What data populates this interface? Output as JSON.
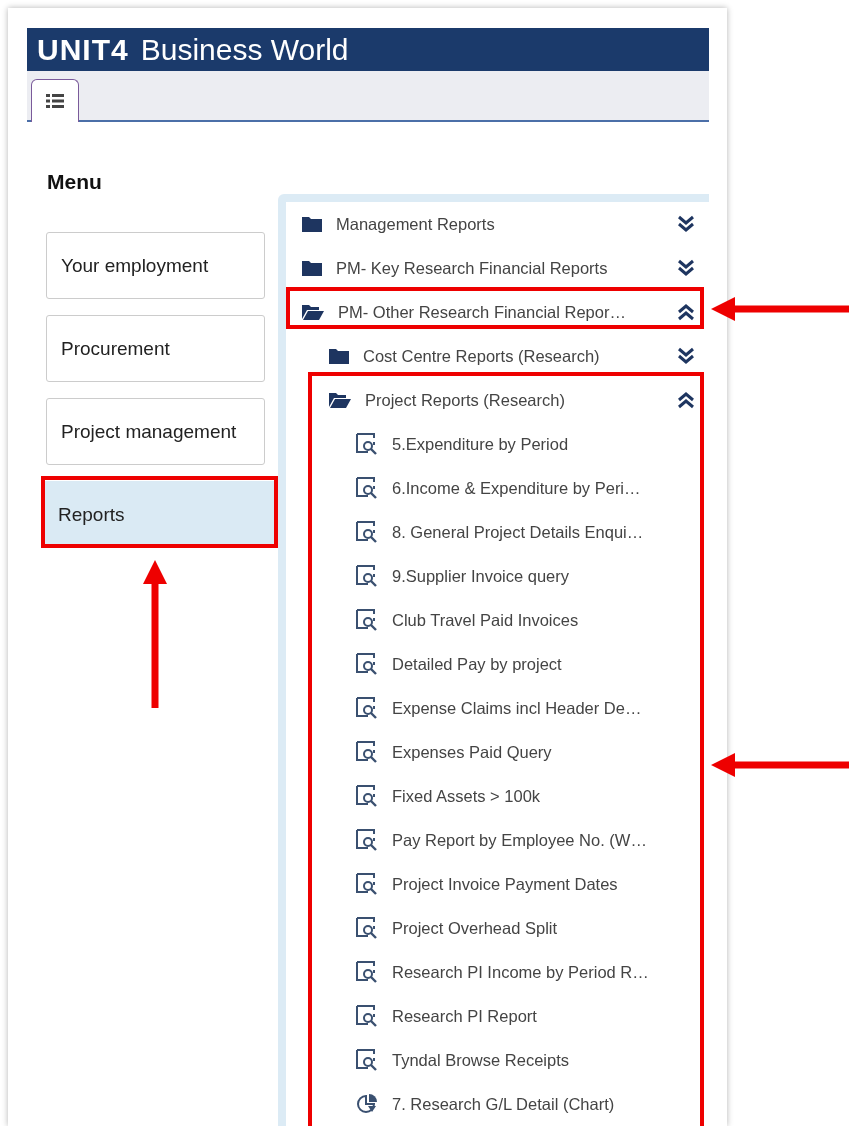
{
  "header": {
    "logo": "UNIT4",
    "title": "Business World"
  },
  "tabs": [
    {
      "selected": true
    }
  ],
  "menu": {
    "title": "Menu",
    "items": [
      {
        "label": "Your employment",
        "selected": false
      },
      {
        "label": "Procurement",
        "selected": false
      },
      {
        "label": "Project management",
        "selected": false
      },
      {
        "label": "Reports",
        "selected": true
      }
    ]
  },
  "tree": [
    {
      "kind": "folder",
      "label": "Management Reports",
      "expanded": false
    },
    {
      "kind": "folder",
      "label": "PM- Key Research Financial Reports",
      "expanded": false
    },
    {
      "kind": "folder",
      "label": "PM- Other Research Financial Repor…",
      "expanded": true,
      "children": [
        {
          "kind": "folder",
          "label": "Cost Centre Reports (Research)",
          "expanded": false
        },
        {
          "kind": "folder",
          "label": "Project Reports (Research)",
          "expanded": true,
          "children": [
            {
              "kind": "report",
              "label": "5.Expenditure by Period"
            },
            {
              "kind": "report",
              "label": "6.Income & Expenditure by Peri…"
            },
            {
              "kind": "report",
              "label": "8. General Project Details Enqui…"
            },
            {
              "kind": "report",
              "label": "9.Supplier Invoice query"
            },
            {
              "kind": "report",
              "label": "Club Travel Paid Invoices"
            },
            {
              "kind": "report",
              "label": "Detailed Pay by project"
            },
            {
              "kind": "report",
              "label": "Expense Claims incl Header De…"
            },
            {
              "kind": "report",
              "label": "Expenses Paid Query"
            },
            {
              "kind": "report",
              "label": "Fixed Assets > 100k"
            },
            {
              "kind": "report",
              "label": "Pay Report by Employee No. (W…"
            },
            {
              "kind": "report",
              "label": "Project Invoice Payment Dates"
            },
            {
              "kind": "report",
              "label": "Project Overhead Split"
            },
            {
              "kind": "report",
              "label": "Research PI Income by Period R…"
            },
            {
              "kind": "report",
              "label": "Research PI Report"
            },
            {
              "kind": "report",
              "label": "Tyndal Browse Receipts"
            },
            {
              "kind": "chart",
              "label": "7. Research G/L Detail (Chart)"
            }
          ]
        }
      ]
    }
  ]
}
